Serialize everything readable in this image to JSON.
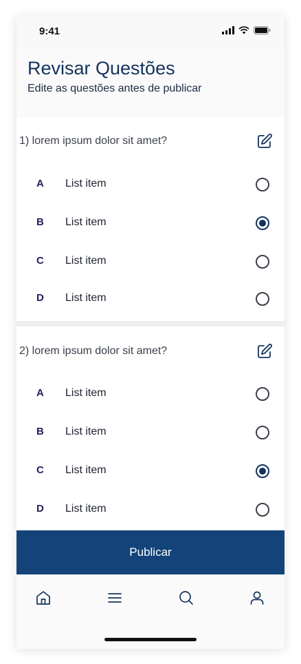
{
  "status_bar": {
    "time": "9:41"
  },
  "header": {
    "title": "Revisar Questões",
    "subtitle": "Edite as questões antes de publicar"
  },
  "questions": [
    {
      "text": "1)  lorem ipsum dolor sit amet?",
      "options": [
        {
          "letter": "A",
          "label": "List item",
          "selected": false
        },
        {
          "letter": "B",
          "label": "List item",
          "selected": true
        },
        {
          "letter": "C",
          "label": "List item",
          "selected": false
        },
        {
          "letter": "D",
          "label": "List item",
          "selected": false
        }
      ]
    },
    {
      "text": "2)  lorem ipsum dolor sit amet?",
      "options": [
        {
          "letter": "A",
          "label": "List item",
          "selected": false
        },
        {
          "letter": "B",
          "label": "List item",
          "selected": false
        },
        {
          "letter": "C",
          "label": "List item",
          "selected": true
        },
        {
          "letter": "D",
          "label": "List item",
          "selected": false
        }
      ]
    }
  ],
  "actions": {
    "publish_label": "Publicar"
  },
  "tab_bar": {
    "items": [
      "home-icon",
      "menu-icon",
      "search-icon",
      "profile-icon"
    ]
  },
  "colors": {
    "primary": "#134379",
    "title": "#13335c",
    "letter": "#2a1b5c"
  }
}
